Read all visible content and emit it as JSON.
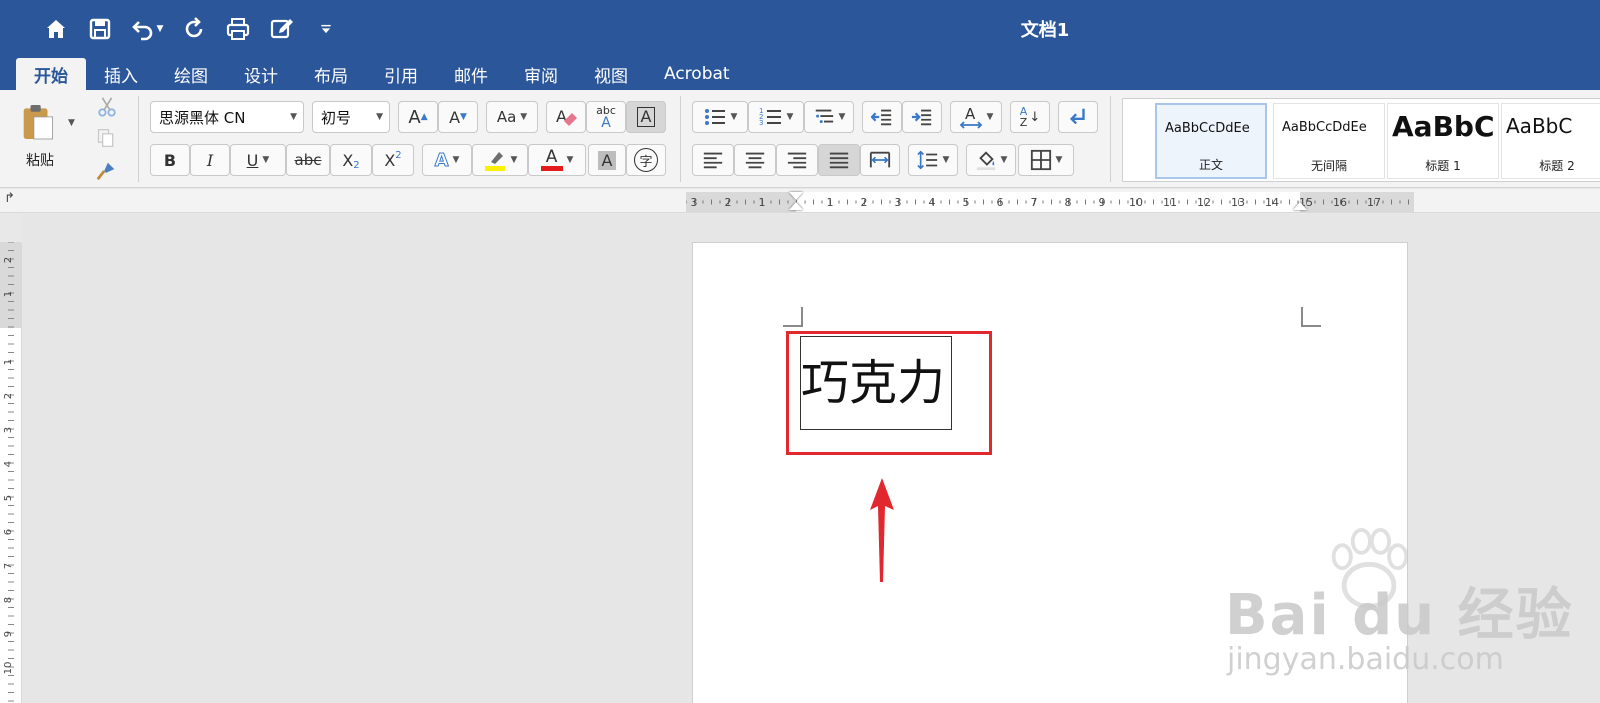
{
  "window": {
    "title": "文档1"
  },
  "qat": {
    "icons": [
      "home-icon",
      "save-icon",
      "undo-icon",
      "redo-icon",
      "print-icon",
      "edit-icon",
      "customize-icon"
    ]
  },
  "tabs": [
    {
      "label": "开始",
      "active": true
    },
    {
      "label": "插入",
      "active": false
    },
    {
      "label": "绘图",
      "active": false
    },
    {
      "label": "设计",
      "active": false
    },
    {
      "label": "布局",
      "active": false
    },
    {
      "label": "引用",
      "active": false
    },
    {
      "label": "邮件",
      "active": false
    },
    {
      "label": "审阅",
      "active": false
    },
    {
      "label": "视图",
      "active": false
    },
    {
      "label": "Acrobat",
      "active": false
    }
  ],
  "ribbon": {
    "paste_label": "粘贴",
    "font_name": "思源黑体 CN",
    "font_size": "初号",
    "bold": "B",
    "italic": "I",
    "underline": "U",
    "strike": "abc",
    "subscript": "X",
    "subscript_mark": "2",
    "superscript": "X",
    "superscript_mark": "2",
    "grow_font": "A",
    "shrink_font": "A",
    "change_case": "Aa",
    "phonetic_top": "abc",
    "phonetic_bottom": "A",
    "char_border": "A",
    "text_effects": "A",
    "font_color": "A",
    "char_shading": "A",
    "enclose_char": "字",
    "sort_top": "A",
    "sort_bottom": "Z"
  },
  "styles": [
    {
      "sample": "AaBbCcDdEe",
      "name": "正文",
      "selected": true
    },
    {
      "sample": "AaBbCcDdEe",
      "name": "无间隔",
      "selected": false
    },
    {
      "sample": "AaBbC",
      "name": "标题 1",
      "selected": false
    },
    {
      "sample": "AaBbC",
      "name": "标题 2",
      "selected": false
    }
  ],
  "ruler": {
    "h_labels": [
      "3",
      "2",
      "1",
      "1",
      "2",
      "3",
      "4",
      "5",
      "6",
      "7",
      "8",
      "9",
      "10",
      "11",
      "12",
      "13",
      "14",
      "15",
      "16",
      "17"
    ],
    "v_labels": [
      "2",
      "1",
      "1",
      "2",
      "3",
      "4",
      "5",
      "6",
      "7",
      "8",
      "9",
      "10"
    ]
  },
  "document": {
    "textbox_text": "巧克力"
  },
  "colors": {
    "accent": "#2b579a",
    "annotation_red": "#e0282e",
    "highlight_yellow": "#ffef00",
    "font_red": "#e31b1b"
  },
  "watermark": {
    "main": "Bai du 经验",
    "sub": "jingyan.baidu.com"
  }
}
